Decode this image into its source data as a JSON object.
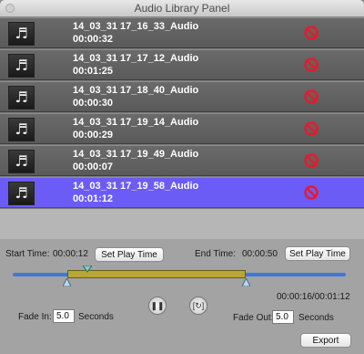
{
  "window": {
    "title": "Audio Library Panel"
  },
  "list": {
    "items": [
      {
        "name": "14_03_31 17_16_33_Audio",
        "duration": "00:00:32",
        "selected": false
      },
      {
        "name": "14_03_31 17_17_12_Audio",
        "duration": "00:01:25",
        "selected": false
      },
      {
        "name": "14_03_31 17_18_40_Audio",
        "duration": "00:00:30",
        "selected": false
      },
      {
        "name": "14_03_31 17_19_14_Audio",
        "duration": "00:00:29",
        "selected": false
      },
      {
        "name": "14_03_31 17_19_49_Audio",
        "duration": "00:00:07",
        "selected": false
      },
      {
        "name": "14_03_31 17_19_58_Audio",
        "duration": "00:01:12",
        "selected": true
      }
    ],
    "thumb_icon": "music-note-icon",
    "thumb_glyph": "♬",
    "delete_icon": "no-sign-icon"
  },
  "controls": {
    "start_label": "Start Time:",
    "start_value": "00:00:12",
    "set_start_label": "Set Play Time",
    "end_label": "End Time:",
    "end_value": "00:00:50",
    "set_end_label": "Set Play Time",
    "position": "00:00:16/00:01:12",
    "fade_in_label": "Fade In:",
    "fade_in_value": "5.0",
    "fade_in_unit": "Seconds",
    "fade_out_label": "Fade Out:",
    "fade_out_value": "5.0",
    "fade_out_unit": "Seconds",
    "export_label": "Export",
    "pause_icon": "pause-icon",
    "loop_icon": "loop-icon"
  },
  "colors": {
    "selected_row": "#6b5cf7",
    "range_fill": "#b8a63a",
    "track": "#3f78d8"
  }
}
